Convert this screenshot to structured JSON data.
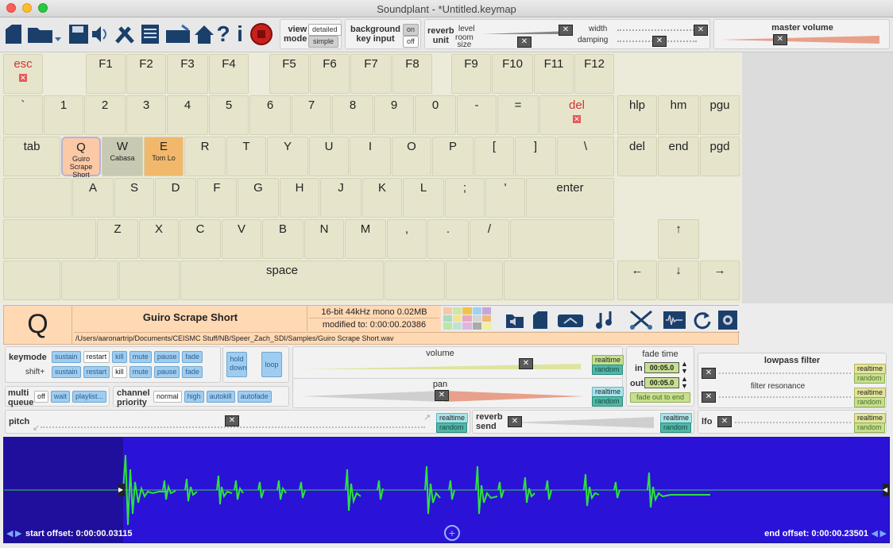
{
  "window": {
    "title": "Soundplant - *Untitled.keymap"
  },
  "toolbar": {
    "icons": [
      "new-file-icon",
      "open-folder-icon",
      "save-icon",
      "audio-export-icon",
      "tools-icon",
      "notes-icon",
      "keyboard-icon",
      "home-icon",
      "help-icon",
      "info-icon",
      "record-icon"
    ],
    "view_mode": {
      "label": "view\nmode",
      "opt1": "detailed",
      "opt2": "simple"
    },
    "background_key_input": {
      "label": "background\nkey input",
      "on": "on",
      "off": "off"
    },
    "reverb_unit": {
      "label": "reverb\nunit",
      "level": "level",
      "room_size": "room\nsize",
      "width": "width",
      "damping": "damping"
    },
    "master_volume": {
      "label": "master volume"
    }
  },
  "keyboard": {
    "fkeys": [
      "esc",
      "F1",
      "F2",
      "F3",
      "F4",
      "F5",
      "F6",
      "F7",
      "F8",
      "F9",
      "F10",
      "F11",
      "F12"
    ],
    "row1": [
      "`",
      "1",
      "2",
      "3",
      "4",
      "5",
      "6",
      "7",
      "8",
      "9",
      "0",
      "-",
      "=",
      "del",
      "hlp",
      "hm",
      "pgu"
    ],
    "row2": [
      "tab",
      "Q",
      "W",
      "E",
      "R",
      "T",
      "Y",
      "U",
      "I",
      "O",
      "P",
      "[",
      "]",
      "\\",
      "del",
      "end",
      "pgd"
    ],
    "row2_samples": {
      "q": "Guiro Scrape Short",
      "w": "Cabasa",
      "e": "Tom Lo"
    },
    "row3": [
      "A",
      "S",
      "D",
      "F",
      "G",
      "H",
      "J",
      "K",
      "L",
      ";",
      "'",
      "enter"
    ],
    "row4": [
      "Z",
      "X",
      "C",
      "V",
      "B",
      "N",
      "M",
      ",",
      ".",
      "/"
    ],
    "space": "space",
    "arrows": {
      "up": "↑",
      "left": "←",
      "down": "↓",
      "right": "→"
    }
  },
  "info": {
    "key": "Q",
    "sample_name": "Guiro Scrape Short",
    "format": "16-bit 44kHz mono 0.02MB",
    "modified": "modified to: 0:00:00.20386",
    "path": "/Users/aaronartrip/Documents/CEISMC Stuff/NB/Speer_Zach_SDI/Samples/Guiro Scrape Short.wav"
  },
  "controls": {
    "keymode": "keymode",
    "shift": "shift+",
    "keymode_opts": [
      "sustain",
      "restart",
      "kill",
      "mute",
      "pause",
      "fade"
    ],
    "hold_down": "hold\ndown",
    "loop": "loop",
    "multi_queue": "multi\nqueue",
    "mq_opts": [
      "off",
      "wait",
      "playlist..."
    ],
    "channel_priority": "channel\npriority",
    "cp_opts": [
      "normal",
      "high",
      "autokill",
      "autofade"
    ],
    "volume": "volume",
    "pan": "pan",
    "realtime": "realtime",
    "random": "random",
    "fade_time": "fade time",
    "fade_in": "in",
    "fade_out": "out",
    "fade_in_val": "00:05.0",
    "fade_out_val": "00:05.0",
    "fade_out_to_end": "fade out to end",
    "lowpass": "lowpass filter",
    "resonance": "filter resonance",
    "pitch": "pitch",
    "reverb_send": "reverb\nsend",
    "lfo": "lfo"
  },
  "waveform": {
    "start_offset": "start offset: 0:00:00.03115",
    "end_offset": "end offset: 0:00:00.23501"
  }
}
